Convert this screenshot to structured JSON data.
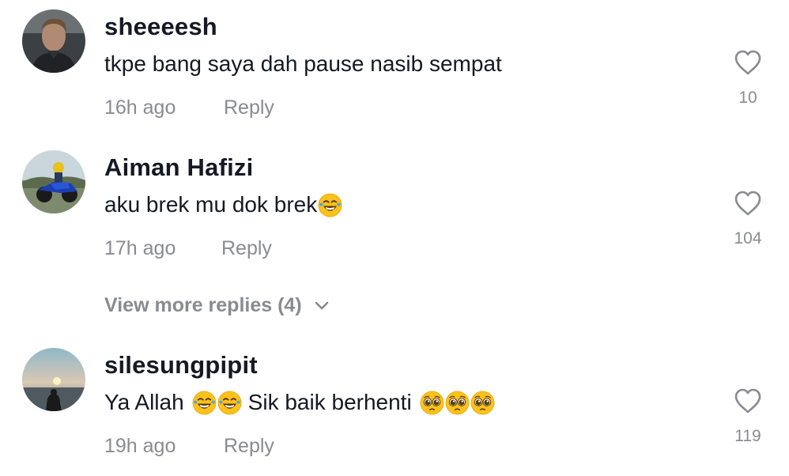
{
  "comments": [
    {
      "username": "sheeeesh",
      "text": "tkpe bang saya dah pause nasib sempat",
      "time": "16h ago",
      "reply_label": "Reply",
      "likes": "10"
    },
    {
      "username": "Aiman Hafizi",
      "text": "aku brek mu dok brek",
      "time": "17h ago",
      "reply_label": "Reply",
      "likes": "104",
      "emojis": [
        "joy"
      ]
    },
    {
      "username": "silesungpipit",
      "text_part1": "Ya Allah",
      "text_part2": "Sik baik berhenti",
      "time": "19h ago",
      "reply_label": "Reply",
      "likes": "119",
      "emojis": [
        "joy",
        "joy",
        "pleading",
        "pleading",
        "pleading"
      ]
    }
  ],
  "view_more": {
    "label": "View more replies (4)"
  },
  "colors": {
    "text": "#161823",
    "muted": "#8a8b91",
    "background": "#ffffff"
  }
}
